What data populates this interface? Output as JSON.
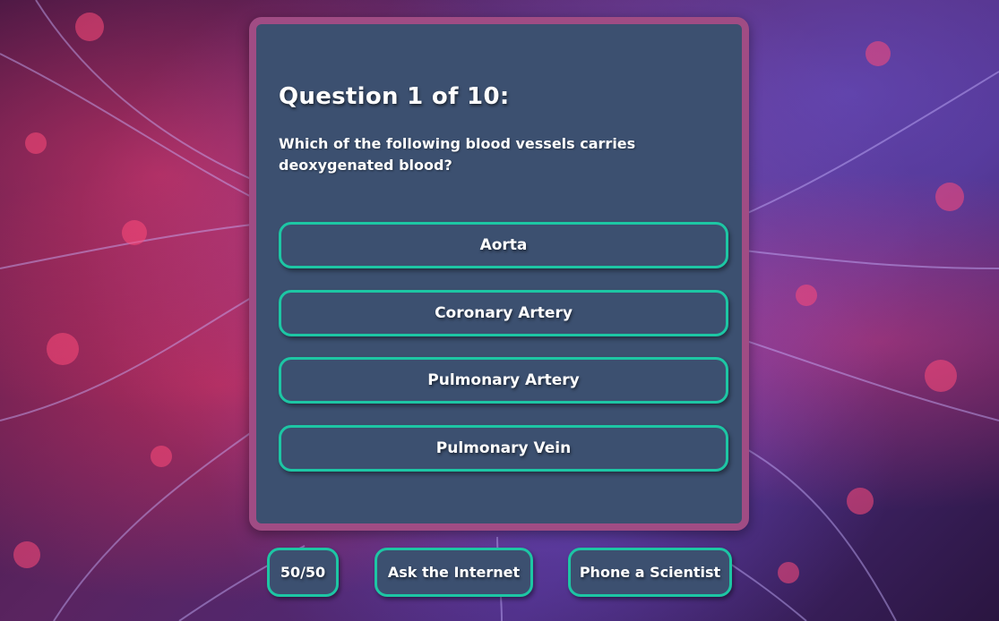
{
  "quiz": {
    "title": "Question 1 of 10:",
    "question": "Which of the following blood vessels carries deoxygenated blood?",
    "answers": [
      {
        "label": "Aorta"
      },
      {
        "label": "Coronary Artery"
      },
      {
        "label": "Pulmonary Artery"
      },
      {
        "label": "Pulmonary Vein"
      }
    ]
  },
  "lifelines": {
    "fifty_fifty": "50/50",
    "ask_internet": "Ask the Internet",
    "phone_scientist": "Phone a Scientist"
  },
  "colors": {
    "card_bg": "#3c5070",
    "card_border": "#a04c84",
    "button_border": "#1dc6a4"
  }
}
